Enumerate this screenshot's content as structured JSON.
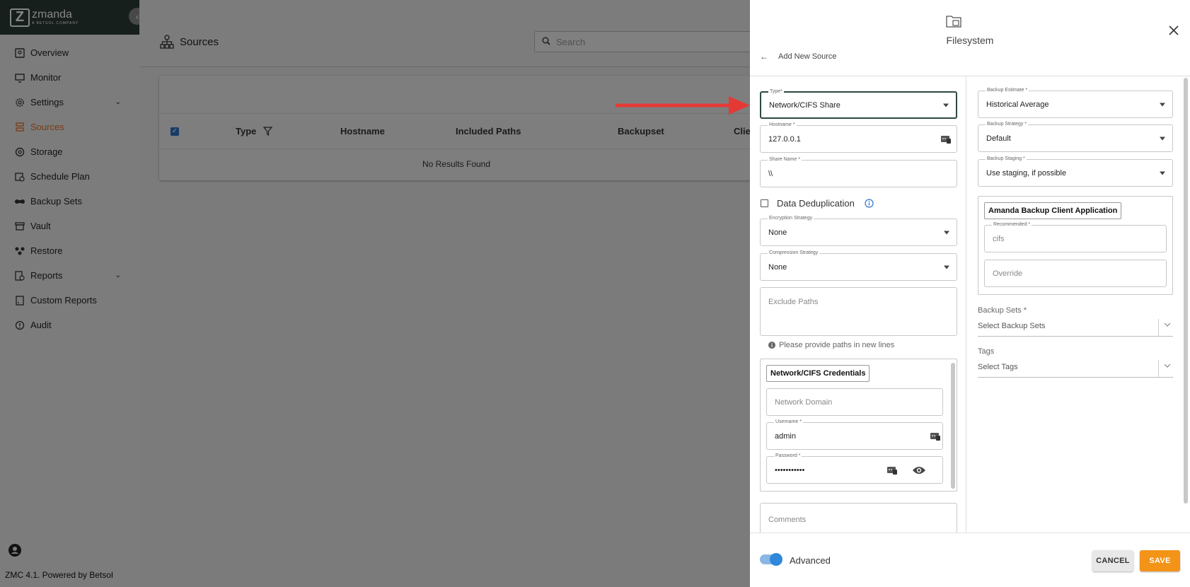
{
  "sidebar": {
    "brand_name": "zmanda",
    "brand_sub": "A BETSOL COMPANY",
    "items": [
      {
        "label": "Overview",
        "icon": "overview-icon"
      },
      {
        "label": "Monitor",
        "icon": "monitor-icon"
      },
      {
        "label": "Settings",
        "icon": "gear-icon"
      },
      {
        "label": "Sources",
        "icon": "sources-icon"
      },
      {
        "label": "Storage",
        "icon": "storage-icon"
      },
      {
        "label": "Schedule Plan",
        "icon": "schedule-icon"
      },
      {
        "label": "Backup Sets",
        "icon": "backup-sets-icon"
      },
      {
        "label": "Vault",
        "icon": "vault-icon"
      },
      {
        "label": "Restore",
        "icon": "restore-icon"
      },
      {
        "label": "Reports",
        "icon": "reports-icon"
      },
      {
        "label": "Custom Reports",
        "icon": "custom-reports-icon"
      },
      {
        "label": "Audit",
        "icon": "audit-icon"
      }
    ],
    "active_item": "Sources",
    "footer": "ZMC 4.1. Powered by Betsol"
  },
  "main": {
    "page_title": "Sources",
    "search_placeholder": "Search",
    "columns": [
      "Type",
      "Hostname",
      "Included Paths",
      "Backupset",
      "Clie"
    ],
    "empty_text": "No Results Found"
  },
  "drawer": {
    "title": "Filesystem",
    "back_label": "Add New Source",
    "left": {
      "type": {
        "label": "Type*",
        "value": "Network/CIFS Share"
      },
      "hostname": {
        "label": "Hostname *",
        "value": "127.0.0.1"
      },
      "share_name": {
        "label": "Share Name *",
        "value": "\\\\"
      },
      "dedup_label": "Data Deduplication",
      "encryption": {
        "label": "Encryption Strategy",
        "value": "None"
      },
      "compression": {
        "label": "Compression Strategy",
        "value": "None"
      },
      "exclude_placeholder": "Exclude Paths",
      "exclude_hint": "Please provide paths in new lines",
      "credentials": {
        "legend": "Network/CIFS Credentials",
        "domain_placeholder": "Network Domain",
        "username": {
          "label": "Username *",
          "value": "admin"
        },
        "password": {
          "label": "Password *",
          "value": "•••••••••••"
        }
      },
      "comments_placeholder": "Comments"
    },
    "right": {
      "backup_estimate": {
        "label": "Backup Estimate *",
        "value": "Historical Average"
      },
      "backup_strategy": {
        "label": "Backup Strategy *",
        "value": "Default"
      },
      "backup_staging": {
        "label": "Backup Staging *",
        "value": "Use staging, if possible"
      },
      "client_app": {
        "legend": "Amanda Backup Client Application",
        "recommended": {
          "label": "Recommended *",
          "value": "cifs"
        },
        "override_placeholder": "Override"
      },
      "backup_sets": {
        "label": "Backup Sets *",
        "placeholder": "Select Backup Sets"
      },
      "tags": {
        "label": "Tags",
        "placeholder": "Select Tags"
      }
    },
    "footer": {
      "advanced_label": "Advanced",
      "cancel_label": "CANCEL",
      "save_label": "SAVE"
    }
  },
  "colors": {
    "accent_orange": "#f39318",
    "active_sidebar": "#e8701f",
    "toggle_blue": "#2f88d9",
    "annotation_arrow": "#e53935"
  }
}
